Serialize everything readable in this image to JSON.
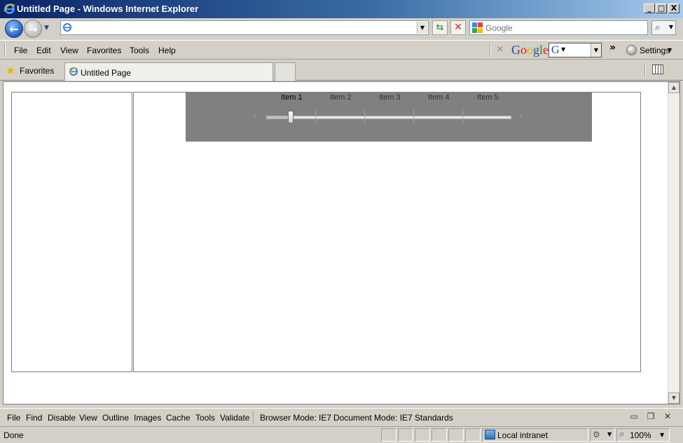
{
  "window": {
    "title": "Untitled Page - Windows Internet Explorer",
    "minimize_glyph": "_",
    "maximize_glyph": "□",
    "close_glyph": "X"
  },
  "address_bar": {
    "url_value": "",
    "search_placeholder": "Google"
  },
  "menu": {
    "items": [
      {
        "label": "File"
      },
      {
        "label": "Edit"
      },
      {
        "label": "View"
      },
      {
        "label": "Favorites"
      },
      {
        "label": "Tools"
      },
      {
        "label": "Help"
      }
    ]
  },
  "google_toolbar": {
    "close_glyph": "×",
    "logo_text": "Google",
    "chevron": "»",
    "settings_label": "Settings"
  },
  "favorites_bar": {
    "favorites_label": "Favorites",
    "tabs": [
      {
        "label": "Untitled Page"
      }
    ]
  },
  "page": {
    "slider": {
      "items": [
        "Item 1",
        "Item 2",
        "Item 3",
        "Item 4",
        "Item 5"
      ],
      "selected_index": 0,
      "value_fraction": 0.1,
      "left_arrow": "‹",
      "right_arrow": "›"
    }
  },
  "dev_toolbar": {
    "items": [
      {
        "label": "File"
      },
      {
        "label": "Find"
      },
      {
        "label": "Disable"
      },
      {
        "label": "View"
      },
      {
        "label": "Outline"
      },
      {
        "label": "Images"
      },
      {
        "label": "Cache"
      },
      {
        "label": "Tools"
      },
      {
        "label": "Validate"
      }
    ],
    "browser_mode": "Browser Mode:  IE7",
    "document_mode": "Document Mode:  IE7 Standards"
  },
  "status_bar": {
    "status_text": "Done",
    "zone_label": "Local intranet",
    "zoom_label": "100%"
  },
  "colors": {
    "title_gradient_start": "#0a246a",
    "chrome": "#d4d0c8",
    "slider_bg": "#808080"
  }
}
